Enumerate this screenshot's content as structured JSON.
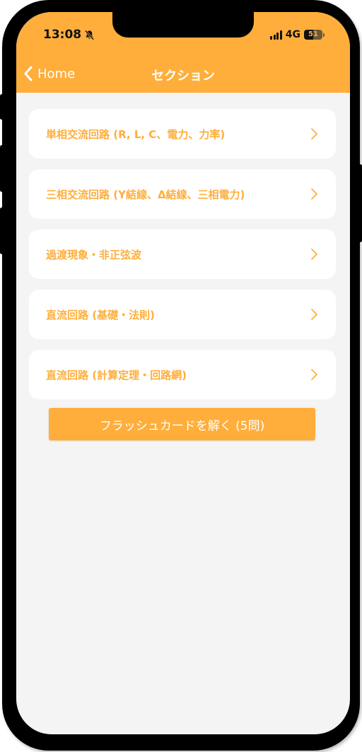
{
  "colors": {
    "accent": "#ffae3b",
    "background": "#f4f4f4",
    "card": "#ffffff"
  },
  "status_bar": {
    "time": "13:08",
    "network": "4G",
    "battery": "51",
    "icons": [
      "bell-slash-icon",
      "signal-icon",
      "battery-icon"
    ]
  },
  "nav": {
    "back_label": "Home",
    "title": "セクション"
  },
  "sections": [
    {
      "label": "単相交流回路 (R, L, C、電力、力率)"
    },
    {
      "label": "三相交流回路 (Y結線、Δ結線、三相電力)"
    },
    {
      "label": "過渡現象・非正弦波"
    },
    {
      "label": "直流回路 (基礎・法則)"
    },
    {
      "label": "直流回路 (計算定理・回路網)"
    }
  ],
  "flashcard_button": {
    "label": "フラッシュカードを解く (5問)"
  }
}
